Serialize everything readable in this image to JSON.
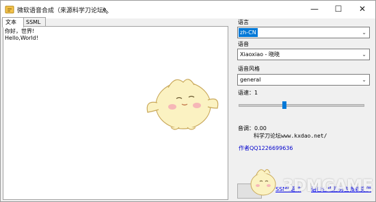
{
  "window": {
    "title": "微软语音合成（来源科学刀论坛）",
    "minimize_icon": "—",
    "maximize_icon": "☐",
    "close_icon": "✕",
    "cursor_glyph": "⇖"
  },
  "tabs": [
    {
      "label": "文本",
      "active": true
    },
    {
      "label": "SSML",
      "active": false
    }
  ],
  "editor": {
    "text": "你好，世界!\nHello,World!"
  },
  "settings": {
    "language_label": "语言",
    "language_value": "zh-CN",
    "voice_label": "语音",
    "voice_value": "Xiaoxiao - 晓晓",
    "style_label": "语音风格",
    "style_value": "general",
    "speed_label": "语速：1",
    "speed_level_fraction": 0.37,
    "pitch_label": "音调：0.00",
    "chevron": "⌄"
  },
  "credits": {
    "site": "科学刀论坛www.kxdao.net/",
    "author": "作者QQ1226699636"
  },
  "footer_links": {
    "left": "SSML语法",
    "right": "语音合成服务由微软提供"
  },
  "watermark": "3DMGAME",
  "colors": {
    "accent": "#0078d7",
    "link": "#0000ee",
    "author": "#0000cc"
  }
}
